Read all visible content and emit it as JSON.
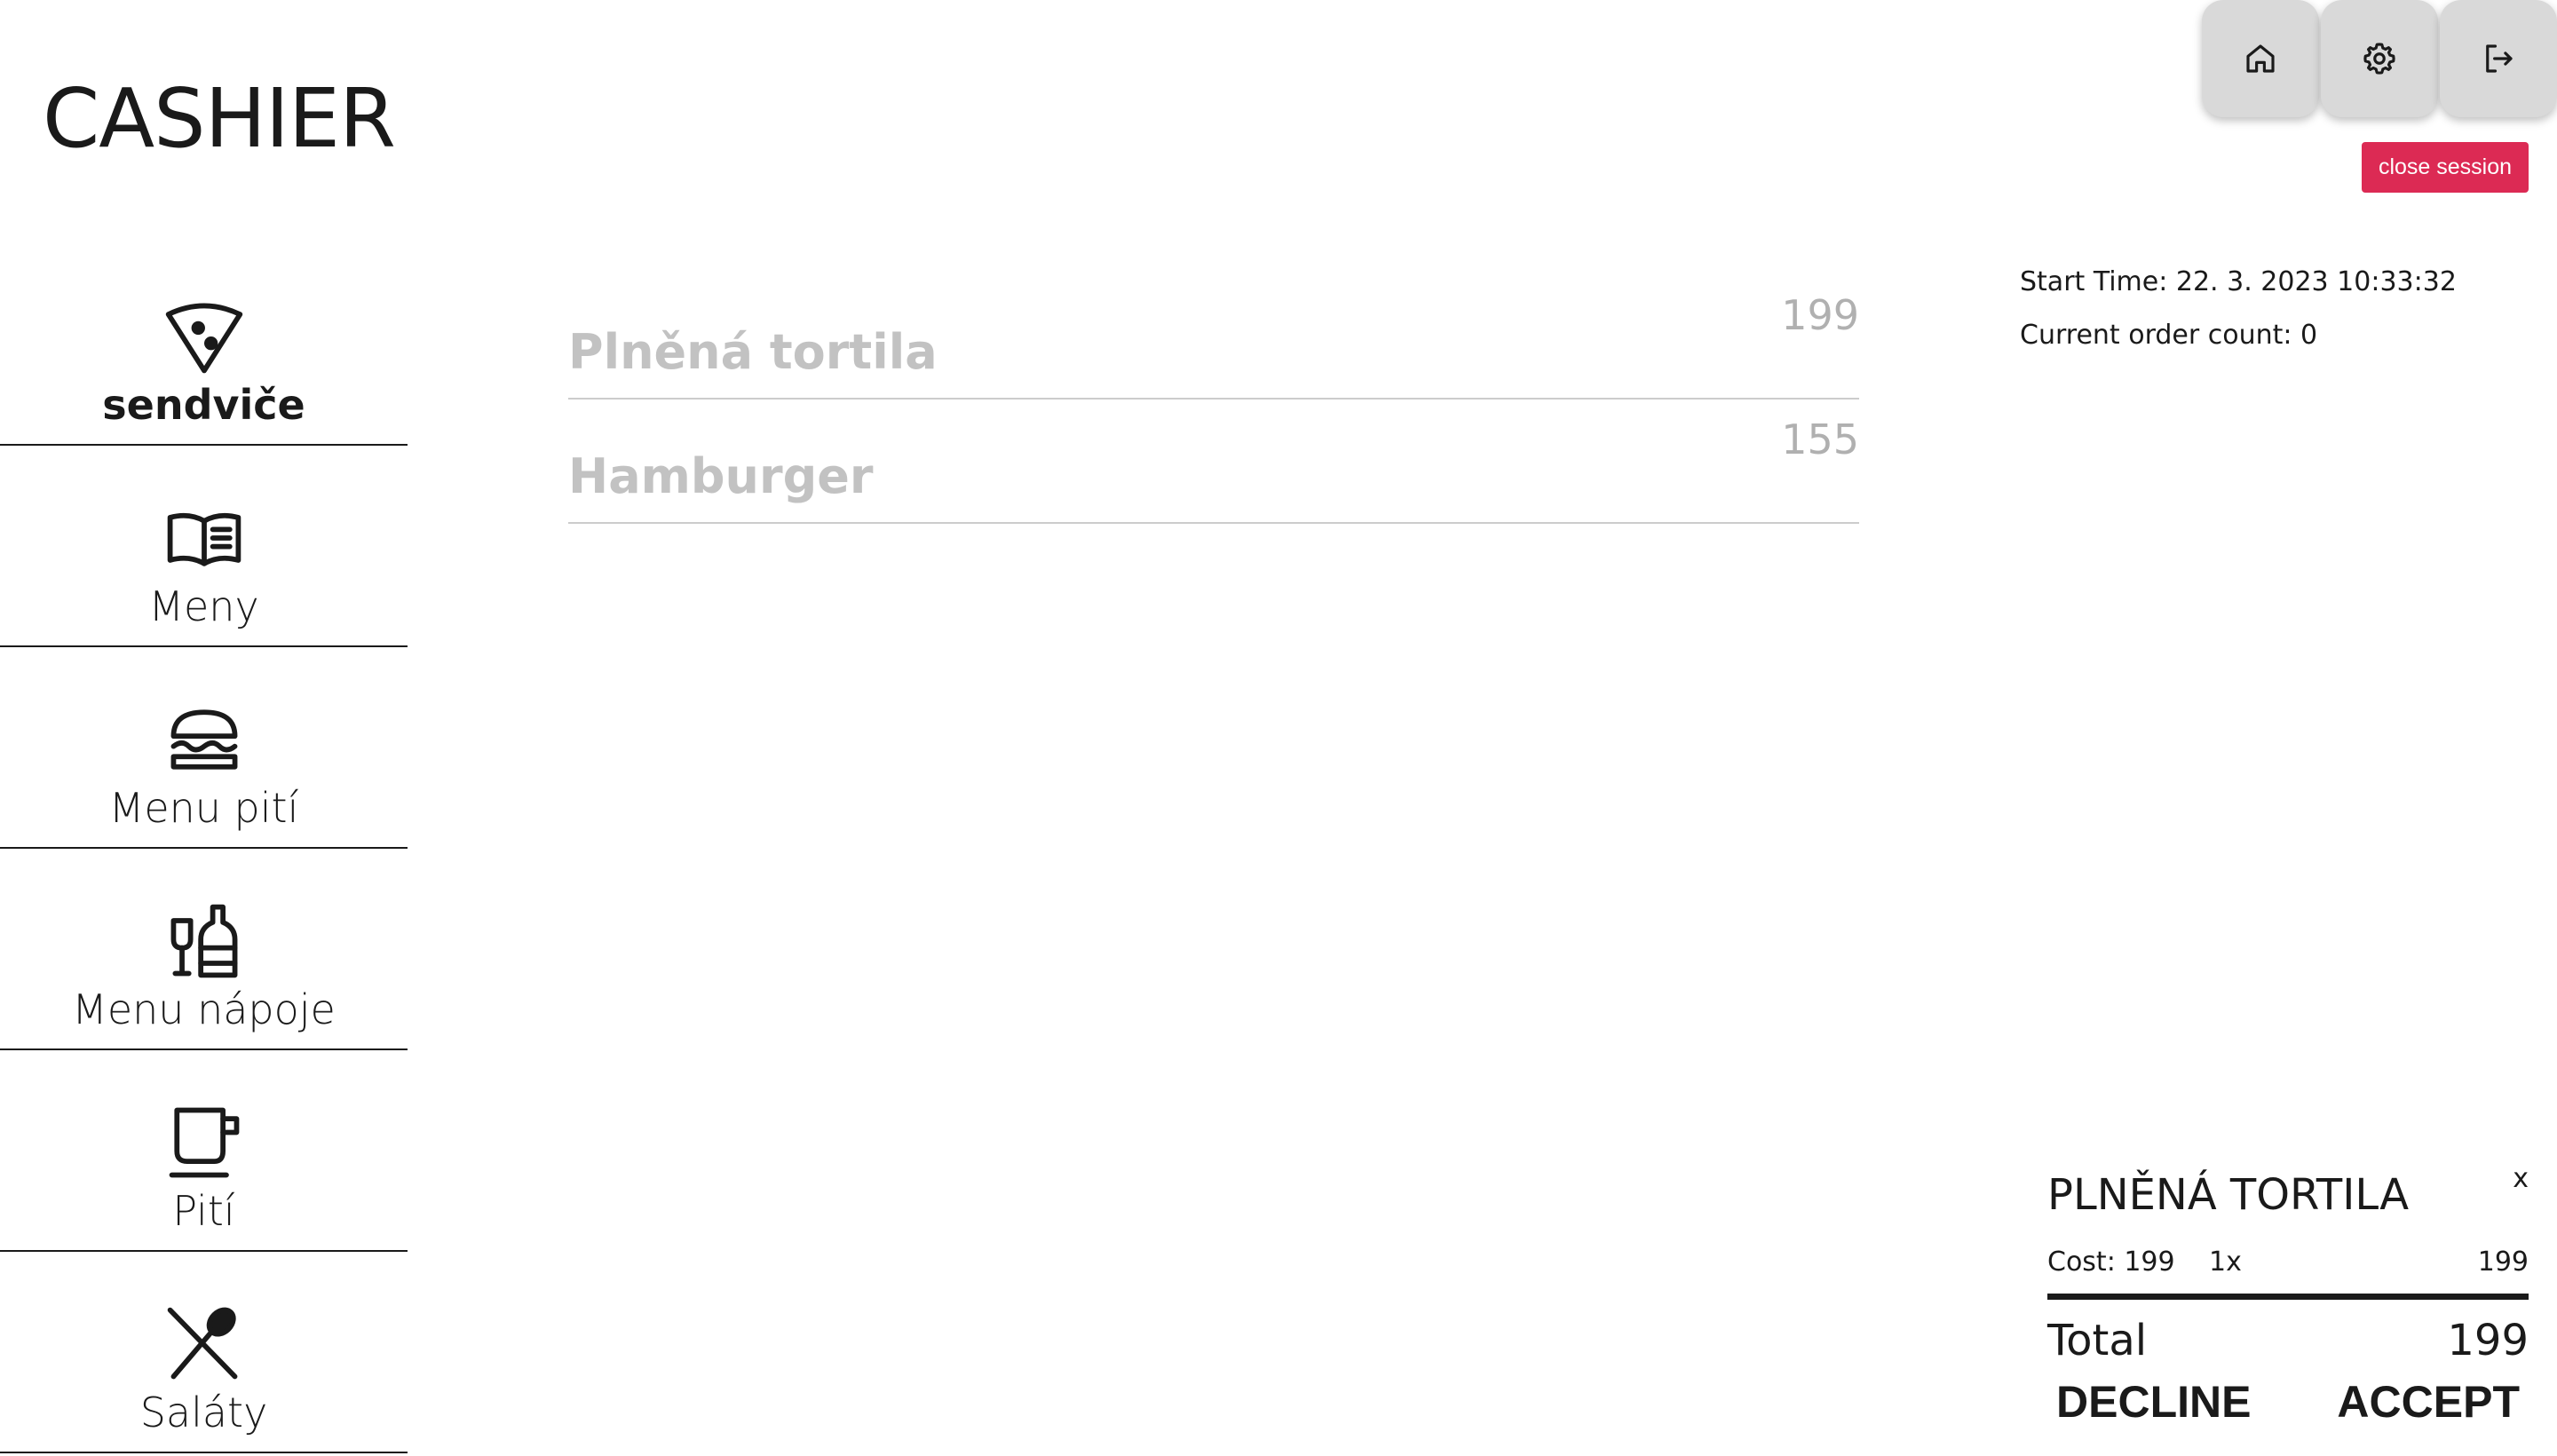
{
  "app": {
    "title": "CASHIER"
  },
  "header": {
    "buttons": [
      {
        "icon": "home-icon"
      },
      {
        "icon": "gear-icon"
      },
      {
        "icon": "logout-icon"
      }
    ],
    "close_session_label": "close session"
  },
  "sidebar": {
    "items": [
      {
        "label": "sendviče",
        "icon": "pizza-slice-icon",
        "active": true
      },
      {
        "label": "Meny",
        "icon": "open-book-icon",
        "active": false
      },
      {
        "label": "Menu pití",
        "icon": "burger-icon",
        "active": false
      },
      {
        "label": "Menu nápoje",
        "icon": "wine-bottle-icon",
        "active": false
      },
      {
        "label": "Pití",
        "icon": "mug-icon",
        "active": false
      },
      {
        "label": "Saláty",
        "icon": "spoon-knife-icon",
        "active": false
      }
    ]
  },
  "products": [
    {
      "name": "Plněná tortila",
      "price": "199"
    },
    {
      "name": "Hamburger",
      "price": "155"
    }
  ],
  "session": {
    "start_time": "Start Time: 22. 3. 2023 10:33:32",
    "order_count": "Current order count: 0"
  },
  "order": {
    "title": "PLNĚNÁ TORTILA",
    "close_label": "x",
    "cost": "Cost: 199",
    "quantity": "1x",
    "line_total": "199",
    "total_label": "Total",
    "total_value": "199",
    "decline_label": "DECLINE",
    "accept_label": "ACCEPT"
  },
  "colors": {
    "accent": "#dc2a54",
    "text": "#1a1a1a",
    "muted_text": "#c2c2c2",
    "button_bg": "#d9d9d9"
  }
}
